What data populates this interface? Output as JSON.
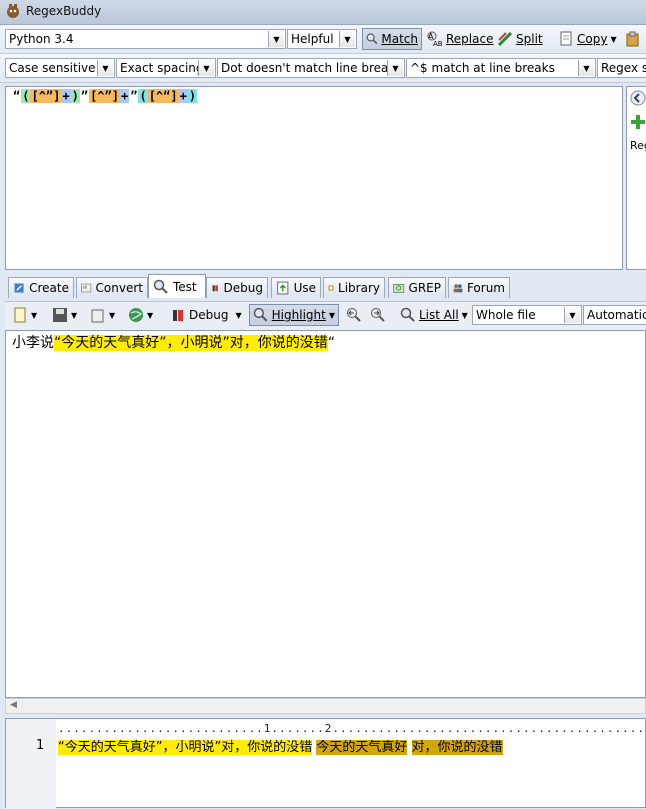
{
  "window": {
    "title": "RegexBuddy"
  },
  "toolbar1": {
    "flavor": "Python 3.4",
    "helpfulness": "Helpful",
    "match_label": "Match",
    "replace_label": "Replace",
    "split_label": "Split",
    "copy_label": "Copy"
  },
  "toolbar2": {
    "case": "Case sensitive",
    "spacing": "Exact spacing",
    "dot": "Dot doesn't match line breaks",
    "anchors": "^$ match at line breaks",
    "syntax": "Regex sy"
  },
  "regex": {
    "tokens": [
      "“",
      "(",
      "[^”]",
      "+",
      ")",
      "”",
      "[^”]",
      "+",
      "”",
      "(",
      "[^“]",
      "+",
      ")"
    ]
  },
  "side_panel": {
    "text": "Reg"
  },
  "tabs": {
    "create": "Create",
    "convert": "Convert",
    "test": "Test",
    "debug": "Debug",
    "use": "Use",
    "library": "Library",
    "grep": "GREP",
    "forum": "Forum"
  },
  "test_toolbar": {
    "debug_label": "Debug",
    "highlight_label": "Highlight",
    "list_all_label": "List All",
    "scope": "Whole file",
    "mode": "Automatic"
  },
  "subject": {
    "plain": "小李说",
    "match": "“今天的天气真好”，小明说”对，你说的没错",
    "tail": "“"
  },
  "results": {
    "ruler": "...........................1.......2..........................................",
    "line_number": "1",
    "segments": {
      "full": "“今天的天气真好”，小明说”对，你说的没错",
      "group1": "今天的天气真好",
      "group2": "对，你说的没错"
    }
  },
  "colors": {
    "highlight_match": "#ffec00",
    "highlight_group": "#d1a60a",
    "group_token": "#9ee8b6",
    "class_token": "#f5b95e",
    "quantifier_token": "#a9c8ff"
  }
}
